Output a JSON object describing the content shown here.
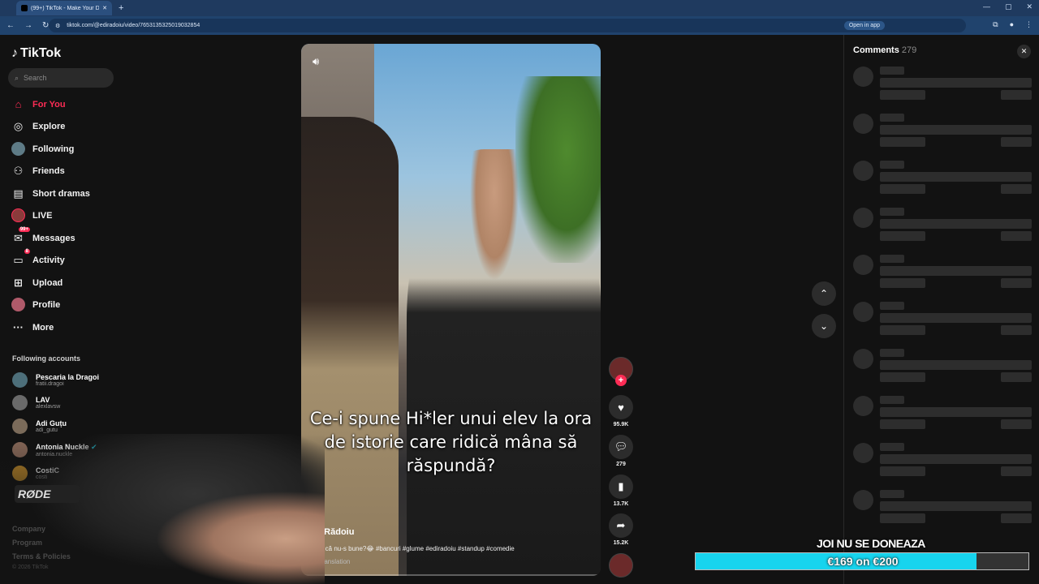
{
  "browser": {
    "tab_title": "(99+) TikTok - Make Your Da",
    "url": "tiktok.com/@ediradoiu/video/7653135325019032854",
    "open_in_app": "Open in app"
  },
  "sidebar": {
    "logo": "TikTok",
    "search_placeholder": "Search",
    "nav": [
      {
        "label": "For You",
        "icon": "home-icon",
        "active": true
      },
      {
        "label": "Explore",
        "icon": "compass-icon"
      },
      {
        "label": "Following",
        "icon": "following-avatar-icon"
      },
      {
        "label": "Friends",
        "icon": "friends-icon"
      },
      {
        "label": "Short dramas",
        "icon": "film-icon"
      },
      {
        "label": "LIVE",
        "icon": "live-icon"
      },
      {
        "label": "Messages",
        "icon": "message-icon",
        "badge": "99+"
      },
      {
        "label": "Activity",
        "icon": "activity-icon",
        "badge": "8"
      },
      {
        "label": "Upload",
        "icon": "upload-icon"
      },
      {
        "label": "Profile",
        "icon": "profile-avatar-icon"
      },
      {
        "label": "More",
        "icon": "more-icon"
      }
    ],
    "following_title": "Following accounts",
    "accounts": [
      {
        "name": "Pescaria la Dragoi",
        "handle": "fratii.dragoi"
      },
      {
        "name": "LAV",
        "handle": "alexlavsw"
      },
      {
        "name": "Adi Guțu",
        "handle": "adi_gutu"
      },
      {
        "name": "Antonia Nuckle",
        "handle": "antonia.nuckle"
      },
      {
        "name": "CostiC",
        "handle": "costi"
      }
    ],
    "footer": {
      "company": "Company",
      "program": "Program",
      "terms": "Terms & Policies",
      "copyright": "© 2026 TikTok"
    }
  },
  "video": {
    "caption": "Ce-i spune Hi*ler unui elev la ora de istorie care ridică mâna să răspundă?",
    "author": "Edi Rădoiu",
    "description": "Na, zi că nu-s bune?😂 #bancuri #glume #ediradoiu #standup #comedie",
    "see_translation": "See translation"
  },
  "actions": {
    "likes": "95.9K",
    "comments": "279",
    "saves": "13.7K",
    "shares": "15.2K"
  },
  "comments_panel": {
    "title": "Comments",
    "count": "279"
  },
  "overlay": {
    "webcam_mic_brand": "RØDE",
    "donation_title": "JOI NU SE DONEAZA",
    "donation_progress": "€169 on €200",
    "donation_fraction": 0.845,
    "donation_color": "#17d4ee"
  },
  "colors": {
    "accent": "#fe2c55",
    "background": "#121212"
  }
}
